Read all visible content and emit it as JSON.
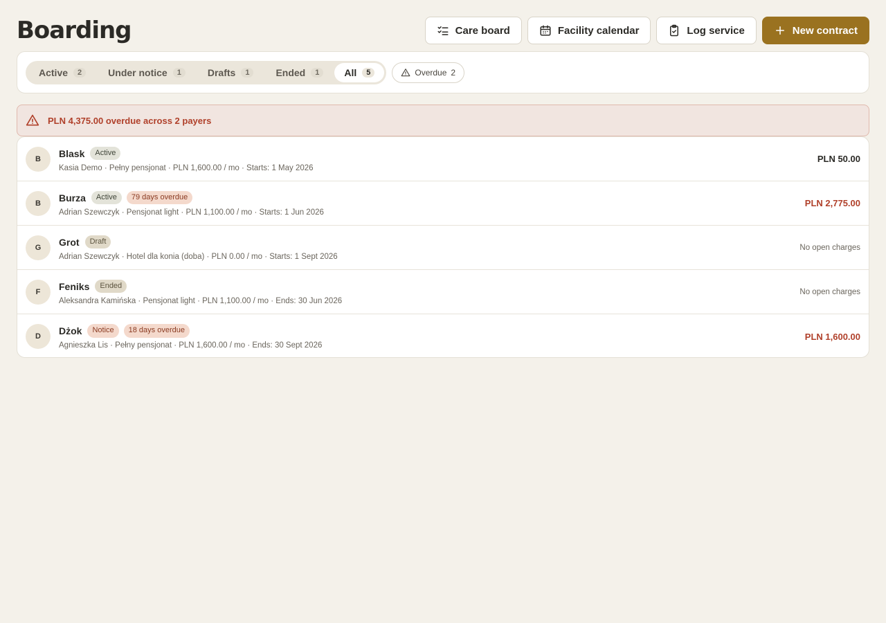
{
  "header": {
    "title": "Boarding",
    "buttons": {
      "care_board": "Care board",
      "facility_calendar": "Facility calendar",
      "log_service": "Log service",
      "new_contract": "New contract"
    }
  },
  "filters": {
    "tabs": [
      {
        "label": "Active",
        "count": "2"
      },
      {
        "label": "Under notice",
        "count": "1"
      },
      {
        "label": "Drafts",
        "count": "1"
      },
      {
        "label": "Ended",
        "count": "1"
      },
      {
        "label": "All",
        "count": "5"
      }
    ],
    "selected": "All",
    "overdue_chip": {
      "label": "Overdue",
      "count": "2"
    }
  },
  "alert": {
    "text": "PLN 4,375.00 overdue across 2 payers"
  },
  "contracts": [
    {
      "initial": "B",
      "name": "Blask",
      "status": "Active",
      "overdue": "",
      "meta": "Kasia Demo · Pełny pensjonat · PLN 1,600.00 / mo · Starts: 1 May 2026",
      "amount": "PLN 50.00"
    },
    {
      "initial": "B",
      "name": "Burza",
      "status": "Active",
      "overdue": "79 days overdue",
      "meta": "Adrian Szewczyk · Pensjonat light · PLN 1,100.00 / mo · Starts: 1 Jun 2026",
      "amount": "PLN 2,775.00"
    },
    {
      "initial": "G",
      "name": "Grot",
      "status": "Draft",
      "overdue": "",
      "meta": "Adrian Szewczyk · Hotel dla konia (doba) · PLN 0.00 / mo · Starts: 1 Sept 2026",
      "amount": "No open charges"
    },
    {
      "initial": "F",
      "name": "Feniks",
      "status": "Ended",
      "overdue": "",
      "meta": "Aleksandra Kamińska · Pensjonat light · PLN 1,100.00 / mo · Ends: 30 Jun 2026",
      "amount": "No open charges"
    },
    {
      "initial": "D",
      "name": "Dżok",
      "status": "Notice",
      "overdue": "18 days overdue",
      "meta": "Agnieszka Lis · Pełny pensjonat · PLN 1,600.00 / mo · Ends: 30 Sept 2026",
      "amount": "PLN 1,600.00"
    }
  ],
  "colors": {
    "background": "#f4f1ea",
    "primary": "#9a7220",
    "danger": "#b0402a",
    "alert_bg": "#f1e5e0"
  },
  "icons": {
    "care_board": "checklist-icon",
    "facility_calendar": "calendar-icon",
    "log_service": "clipboard-check-icon",
    "new_contract": "plus-icon",
    "overdue": "warning-triangle-icon",
    "alert": "warning-triangle-icon"
  }
}
